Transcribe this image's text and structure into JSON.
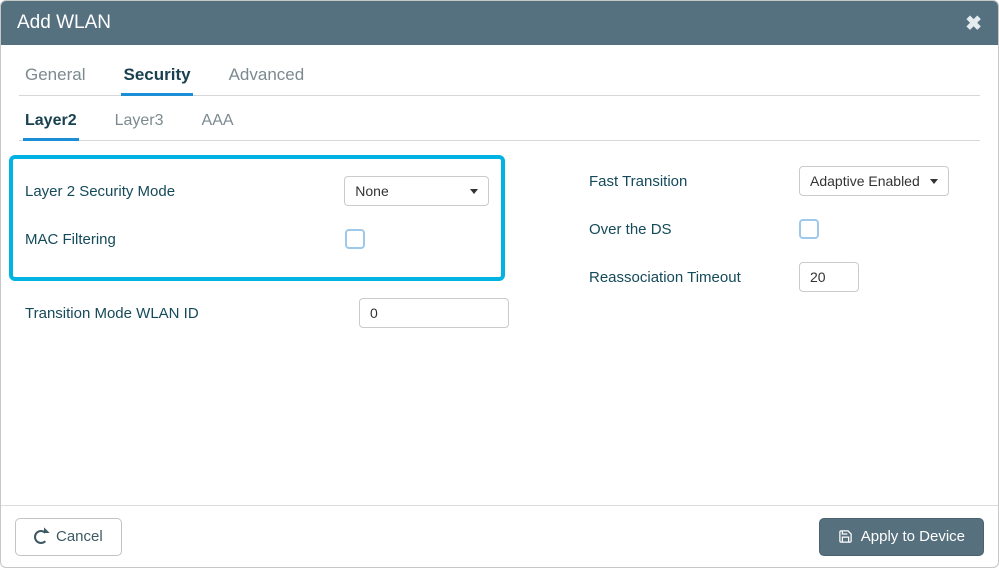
{
  "modal": {
    "title": "Add WLAN"
  },
  "tabs": {
    "main": [
      "General",
      "Security",
      "Advanced"
    ],
    "sub": [
      "Layer2",
      "Layer3",
      "AAA"
    ]
  },
  "form": {
    "left": {
      "security_mode_label": "Layer 2 Security Mode",
      "security_mode_value": "None",
      "mac_filtering_label": "MAC Filtering",
      "transition_mode_label": "Transition Mode WLAN ID",
      "transition_mode_value": "0"
    },
    "right": {
      "fast_transition_label": "Fast Transition",
      "fast_transition_value": "Adaptive Enabled",
      "over_ds_label": "Over the DS",
      "reassoc_timeout_label": "Reassociation Timeout",
      "reassoc_timeout_value": "20"
    }
  },
  "footer": {
    "cancel": "Cancel",
    "apply": "Apply to Device"
  }
}
